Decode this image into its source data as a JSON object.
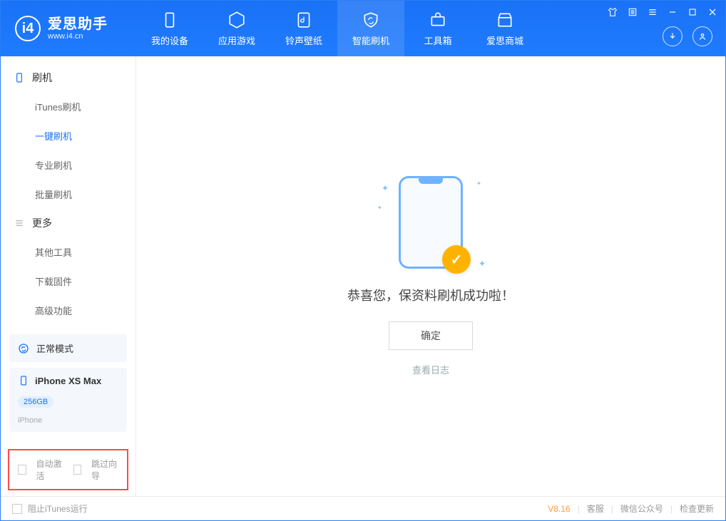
{
  "app": {
    "name": "爱思助手",
    "site": "www.i4.cn"
  },
  "nav": {
    "items": [
      {
        "label": "我的设备"
      },
      {
        "label": "应用游戏"
      },
      {
        "label": "铃声壁纸"
      },
      {
        "label": "智能刷机"
      },
      {
        "label": "工具箱"
      },
      {
        "label": "爱思商城"
      }
    ],
    "active_index": 3
  },
  "sidebar": {
    "group1_title": "刷机",
    "group1_items": [
      {
        "label": "iTunes刷机"
      },
      {
        "label": "一键刷机"
      },
      {
        "label": "专业刷机"
      },
      {
        "label": "批量刷机"
      }
    ],
    "group1_active_index": 1,
    "group2_title": "更多",
    "group2_items": [
      {
        "label": "其他工具"
      },
      {
        "label": "下载固件"
      },
      {
        "label": "高级功能"
      }
    ]
  },
  "mode_card": {
    "label": "正常模式"
  },
  "device_card": {
    "name": "iPhone XS Max",
    "storage": "256GB",
    "type": "iPhone"
  },
  "bottom_options": {
    "opt1": "自动激活",
    "opt2": "跳过向导"
  },
  "main": {
    "success_text": "恭喜您，保资料刷机成功啦！",
    "ok_button": "确定",
    "view_log": "查看日志"
  },
  "footer": {
    "block_itunes": "阻止iTunes运行",
    "version": "V8.16",
    "link1": "客服",
    "link2": "微信公众号",
    "link3": "检查更新"
  }
}
